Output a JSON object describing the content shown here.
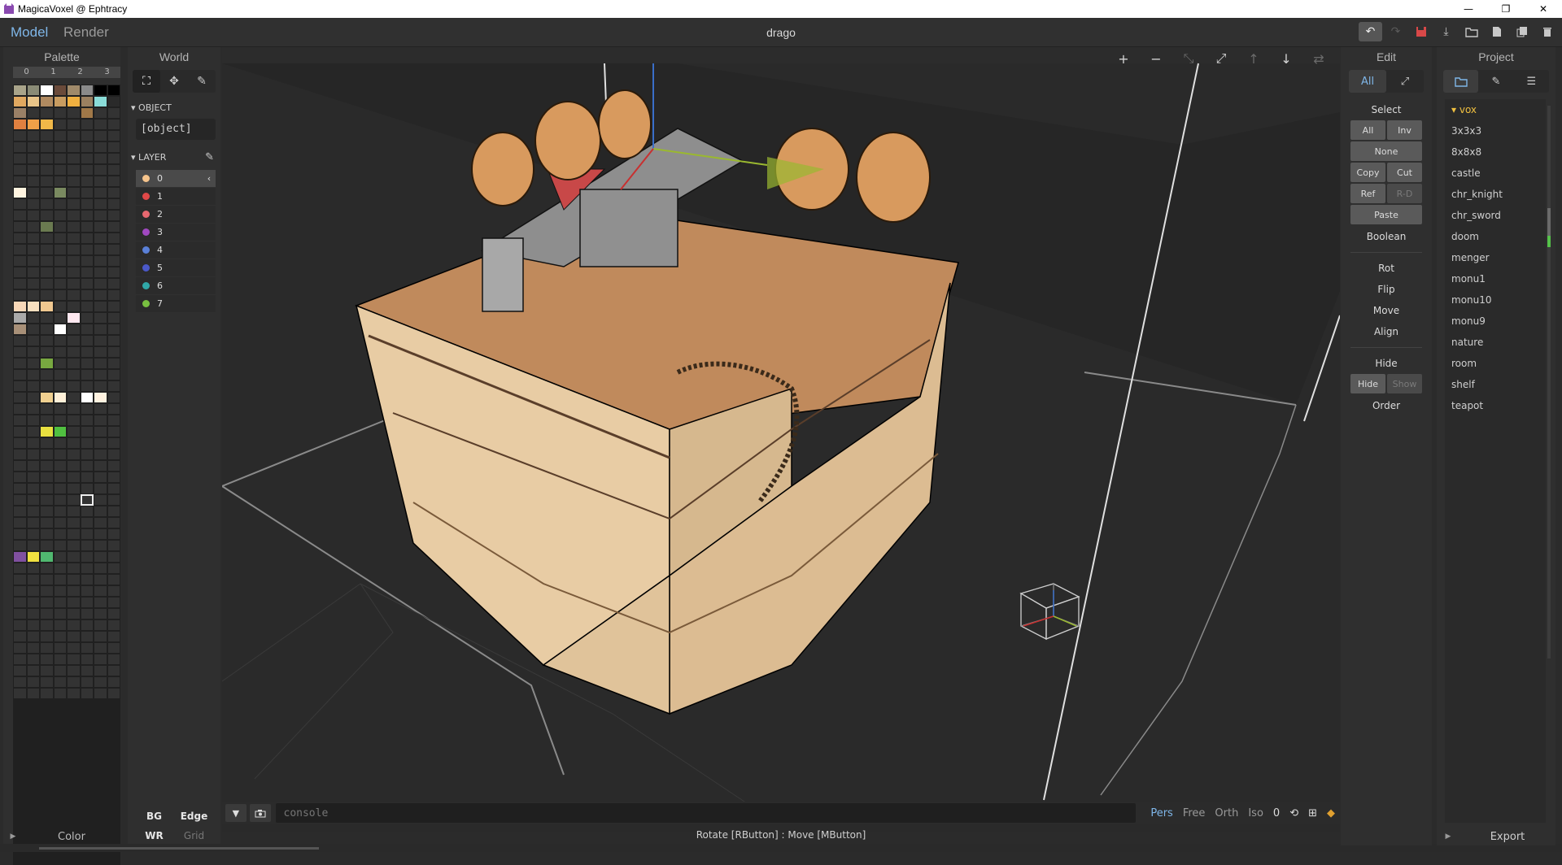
{
  "window": {
    "title": "MagicaVoxel @ Ephtracy",
    "minimize": "—",
    "restore": "❐",
    "close": "✕"
  },
  "topbar": {
    "tab_model": "Model",
    "tab_render": "Render",
    "doc_title": "drago"
  },
  "palette": {
    "title": "Palette",
    "columns": [
      "0",
      "1",
      "2",
      "3"
    ],
    "footer": "Color",
    "colors": {
      "r0": [
        "#a9a48a",
        "#8a8b76",
        "#ffffff",
        "#6a4a3a",
        "#a08a6a",
        "#8a8a8a",
        "#000000",
        "#000000"
      ],
      "r1": [
        "#e0a860",
        "#e8c488",
        "#b08a60",
        "#c89c60",
        "#f0b040",
        "#9a8060",
        "#8adcd8",
        "#2a2a2a"
      ],
      "r2": [
        "#9a8066",
        "#333333",
        "#333333",
        "#333333",
        "#333333",
        "#a07848",
        "#333333",
        "#333333"
      ],
      "r3": [
        "#e08040",
        "#f0a048",
        "#f0b848",
        "#333333",
        "#333333",
        "#333333",
        "#333333",
        "#333333"
      ],
      "accent": [
        "#fff4e0",
        "#7a8a60",
        "#6a7a50",
        "#f8d8b8",
        "#f8e0c0",
        "#f0c890",
        "#aaaaaa",
        "#ffe8f0",
        "#a89078",
        "#ffffff",
        "#78a840",
        "#f0d090",
        "#fff0d8",
        "#ffffff",
        "#fff2e0",
        "#e8e040",
        "#50c040",
        "#8050a0",
        "#f0e040",
        "#50b870"
      ]
    }
  },
  "world": {
    "title": "World",
    "object_section": "OBJECT",
    "object_value": "[object]",
    "layer_section": "LAYER",
    "layers": [
      {
        "name": "0",
        "color": "#f6c48c"
      },
      {
        "name": "1",
        "color": "#e04848"
      },
      {
        "name": "2",
        "color": "#e86870"
      },
      {
        "name": "3",
        "color": "#a048c0"
      },
      {
        "name": "4",
        "color": "#5a80d8"
      },
      {
        "name": "5",
        "color": "#4a58c8"
      },
      {
        "name": "6",
        "color": "#30a8a8"
      },
      {
        "name": "7",
        "color": "#78c040"
      }
    ],
    "foot_bg": "BG",
    "foot_edge": "Edge",
    "foot_wr": "WR",
    "foot_grid": "Grid"
  },
  "viewport": {
    "console_placeholder": "console",
    "view_modes": [
      "Pers",
      "Free",
      "Orth",
      "Iso"
    ],
    "zoom_value": "0",
    "status": "Rotate [RButton] : Move [MButton]"
  },
  "edit": {
    "title": "Edit",
    "scope_all": "All",
    "select_label": "Select",
    "btn_all": "All",
    "btn_inv": "Inv",
    "btn_none": "None",
    "btn_copy": "Copy",
    "btn_cut": "Cut",
    "btn_ref": "Ref",
    "btn_rd": "R-D",
    "btn_paste": "Paste",
    "boolean": "Boolean",
    "rot": "Rot",
    "flip": "Flip",
    "move": "Move",
    "align": "Align",
    "hide_label": "Hide",
    "btn_hide": "Hide",
    "btn_show": "Show",
    "order": "Order"
  },
  "project": {
    "title": "Project",
    "folder": "vox",
    "files": [
      "3x3x3",
      "8x8x8",
      "castle",
      "chr_knight",
      "chr_sword",
      "doom",
      "menger",
      "monu1",
      "monu10",
      "monu9",
      "nature",
      "room",
      "shelf",
      "teapot"
    ],
    "footer": "Export"
  }
}
